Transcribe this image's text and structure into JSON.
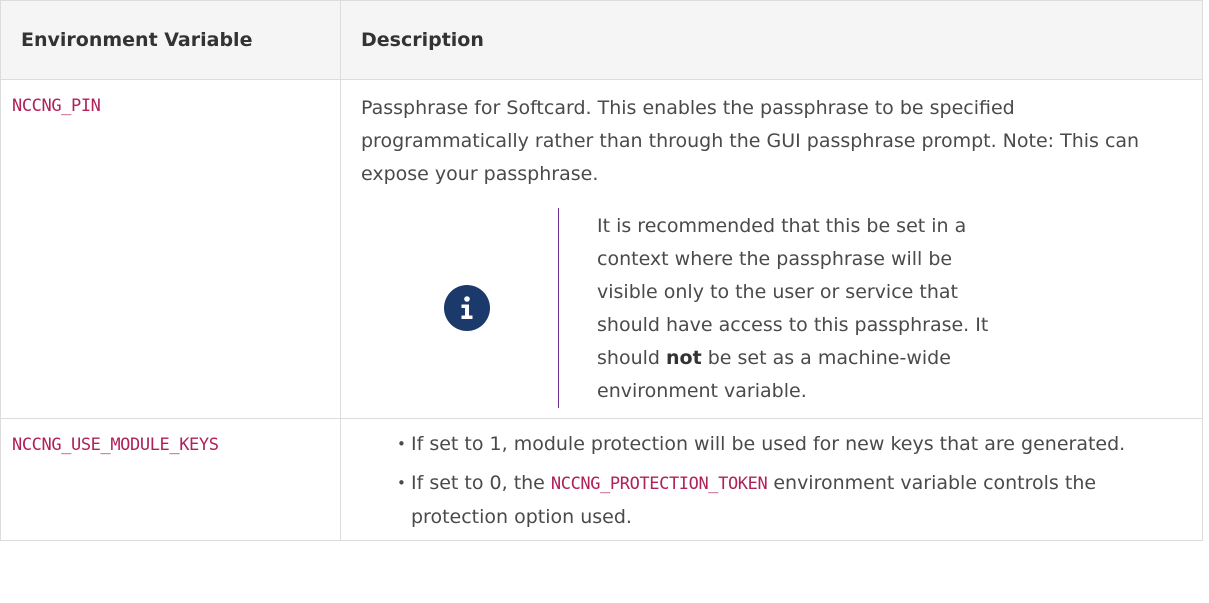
{
  "table": {
    "headers": [
      "Environment Variable",
      "Description"
    ],
    "rows": [
      {
        "variable": "NCCNG_PIN",
        "description": "Passphrase for Softcard. This enables the passphrase to be specified programmatically rather than through the GUI passphrase prompt. Note: This can expose your passphrase.",
        "note": {
          "icon": "info-icon",
          "before_bold": "It is recommended that this be set in a context where the passphrase will be visible only to the user or service that should have access to this passphrase. It should ",
          "bold": "not",
          "after_bold": " be set as a machine-wide environment variable."
        }
      },
      {
        "variable": "NCCNG_USE_MODULE_KEYS",
        "bullets": [
          {
            "text": "If set to 1, module protection will be used for new keys that are generated."
          },
          {
            "before_code": "If set to 0, the ",
            "code": "NCCNG_PROTECTION_TOKEN",
            "after_code": " environment variable controls the protection option used."
          }
        ]
      }
    ]
  },
  "colors": {
    "code": "#b0215a",
    "icon_bg": "#1b3a6b",
    "note_border": "#6f2c91",
    "header_bg": "#f5f5f5"
  }
}
